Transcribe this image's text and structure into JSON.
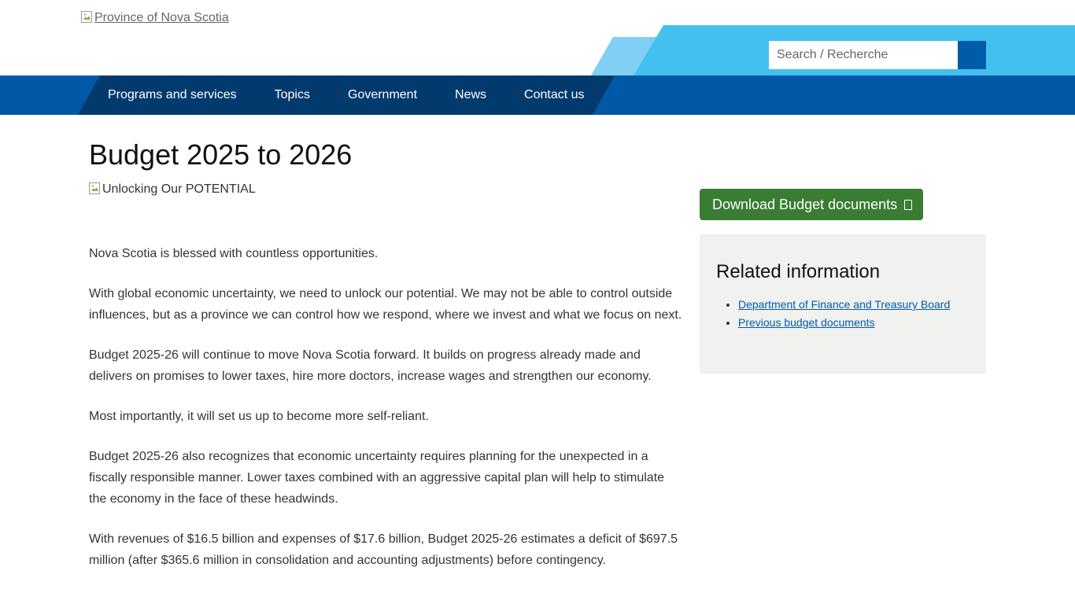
{
  "header": {
    "logo_alt": "Province of Nova Scotia",
    "search": {
      "placeholder": "Search / Recherche",
      "value": ""
    }
  },
  "nav": {
    "items": [
      {
        "label": "Programs and services"
      },
      {
        "label": "Topics"
      },
      {
        "label": "Government"
      },
      {
        "label": "News"
      },
      {
        "label": "Contact us"
      }
    ]
  },
  "main": {
    "title": "Budget 2025 to 2026",
    "hero_alt": "Unlocking Our POTENTIAL",
    "paragraphs": [
      "Nova Scotia is blessed with countless opportunities.",
      "With global economic uncertainty, we need to unlock our potential. We may not be able to control outside influences, but as a province we can control how we respond, where we invest and what we focus on next.",
      "Budget 2025-26 will continue to move Nova Scotia forward. It builds on progress already made and delivers on promises to lower taxes, hire more doctors, increase wages and strengthen our economy.",
      "Most importantly, it will set us up to become more self-reliant.",
      "Budget 2025-26 also recognizes that economic uncertainty requires planning for the unexpected in a fiscally responsible manner. Lower taxes combined with an aggressive capital plan will help to stimulate the economy in the face of these headwinds.",
      "With revenues of $16.5 billion and expenses of $17.6 billion, Budget 2025-26 estimates a deficit of $697.5 million (after $365.6 million in consolidation and accounting adjustments) before contingency."
    ]
  },
  "sidebar": {
    "download_label": "Download Budget documents",
    "related_title": "Related information",
    "related_links": [
      {
        "label": "Department of Finance and Treasury Board"
      },
      {
        "label": "Previous budget documents"
      }
    ]
  },
  "colors": {
    "nav_bg": "#0058a6",
    "nav_dark": "#023a6d",
    "accent_light": "#7fd0f4",
    "accent_mid": "#44c0ef",
    "download_green": "#3a7d32",
    "link_blue": "#005ba9",
    "related_bg": "#f1f1ef"
  },
  "icons": {
    "broken_image": "broken-image-icon",
    "search": "search-icon",
    "download": "document-icon"
  }
}
